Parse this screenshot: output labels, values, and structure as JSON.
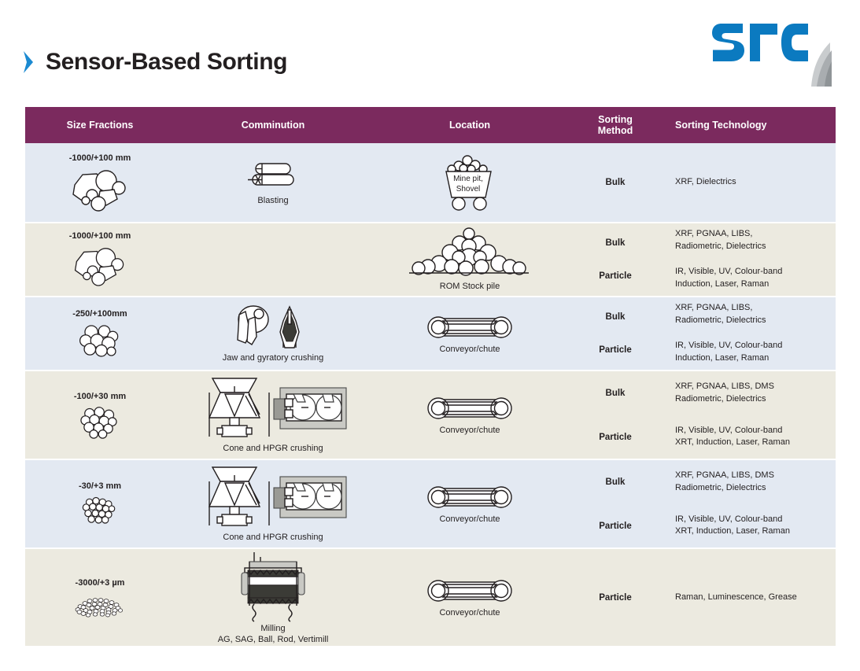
{
  "header": {
    "title": "Sensor-Based Sorting",
    "bullet_icon": "chevron-right-icon",
    "logo_text": "src",
    "logo_color": "#0b7ac0",
    "accent_color": "#1b8ad1"
  },
  "table": {
    "header_bg": "#7B2A5E",
    "row_bg_a": "#E3E9F2",
    "row_bg_b": "#ECEAE0",
    "columns": [
      {
        "id": "size_fractions",
        "label": "Size Fractions"
      },
      {
        "id": "comminution",
        "label": "Comminution"
      },
      {
        "id": "location",
        "label": "Location"
      },
      {
        "id": "sorting_method",
        "label": "Sorting\nMethod",
        "line1": "Sorting",
        "line2": "Method"
      },
      {
        "id": "sorting_technology",
        "label": "Sorting Technology"
      }
    ],
    "rows": [
      {
        "size_fraction": "-1000/+100 mm",
        "size_icon": "rock-cluster-large-icon",
        "comminution_icon": "blasting-dynamite-icon",
        "comminution_caption": "Blasting",
        "location_icon": "mine-cart-icon",
        "location_caption": "",
        "cart_line1": "Mine pit,",
        "cart_line2": "Shovel",
        "methods": [
          "Bulk"
        ],
        "technologies": [
          "XRF, Dielectrics"
        ]
      },
      {
        "size_fraction": "-1000/+100 mm",
        "size_icon": "rock-cluster-large-icon",
        "comminution_icon": "",
        "comminution_caption": "",
        "location_icon": "rom-stockpile-icon",
        "location_caption": "ROM Stock pile",
        "methods": [
          "Bulk",
          "Particle"
        ],
        "technologies": [
          "XRF, PGNAA, LIBS,\nRadiometric, Dielectrics",
          "IR, Visible, UV, Colour-band\nInduction, Laser, Raman"
        ]
      },
      {
        "size_fraction": "-250/+100mm",
        "size_icon": "rock-cluster-medium-icon",
        "comminution_icon": "jaw-gyratory-crusher-icon",
        "comminution_caption": "Jaw and gyratory crushing",
        "location_icon": "conveyor-icon",
        "location_caption": "Conveyor/chute",
        "methods": [
          "Bulk",
          "Particle"
        ],
        "technologies": [
          "XRF, PGNAA, LIBS,\nRadiometric, Dielectrics",
          "IR, Visible, UV, Colour-band\nInduction, Laser, Raman"
        ]
      },
      {
        "size_fraction": "-100/+30 mm",
        "size_icon": "rock-cluster-small-icon",
        "comminution_icon": "cone-hpgr-crusher-icon",
        "comminution_caption": "Cone and HPGR crushing",
        "location_icon": "conveyor-icon",
        "location_caption": "Conveyor/chute",
        "methods": [
          "Bulk",
          "Particle"
        ],
        "technologies": [
          "XRF, PGNAA, LIBS, DMS\nRadiometric, Dielectrics",
          "IR, Visible, UV, Colour-band\nXRT, Induction, Laser, Raman"
        ]
      },
      {
        "size_fraction": "-30/+3 mm",
        "size_icon": "rock-cluster-fine-icon",
        "comminution_icon": "cone-hpgr-crusher-icon",
        "comminution_caption": "Cone and HPGR crushing",
        "location_icon": "conveyor-icon",
        "location_caption": "Conveyor/chute",
        "methods": [
          "Bulk",
          "Particle"
        ],
        "technologies": [
          "XRF, PGNAA, LIBS, DMS\nRadiometric, Dielectrics",
          "IR, Visible, UV, Colour-band\nXRT, Induction, Laser, Raman"
        ]
      },
      {
        "size_fraction": "-3000/+3 µm",
        "size_icon": "powder-pile-icon",
        "comminution_icon": "mill-icon",
        "comminution_caption": "Milling\nAG, SAG, Ball, Rod, Vertimill",
        "comminution_caption_l1": "Milling",
        "comminution_caption_l2": "AG, SAG, Ball, Rod, Vertimill",
        "location_icon": "conveyor-icon",
        "location_caption": "Conveyor/chute",
        "methods": [
          "Particle"
        ],
        "technologies": [
          "Raman, Luminescence, Grease"
        ]
      }
    ]
  }
}
